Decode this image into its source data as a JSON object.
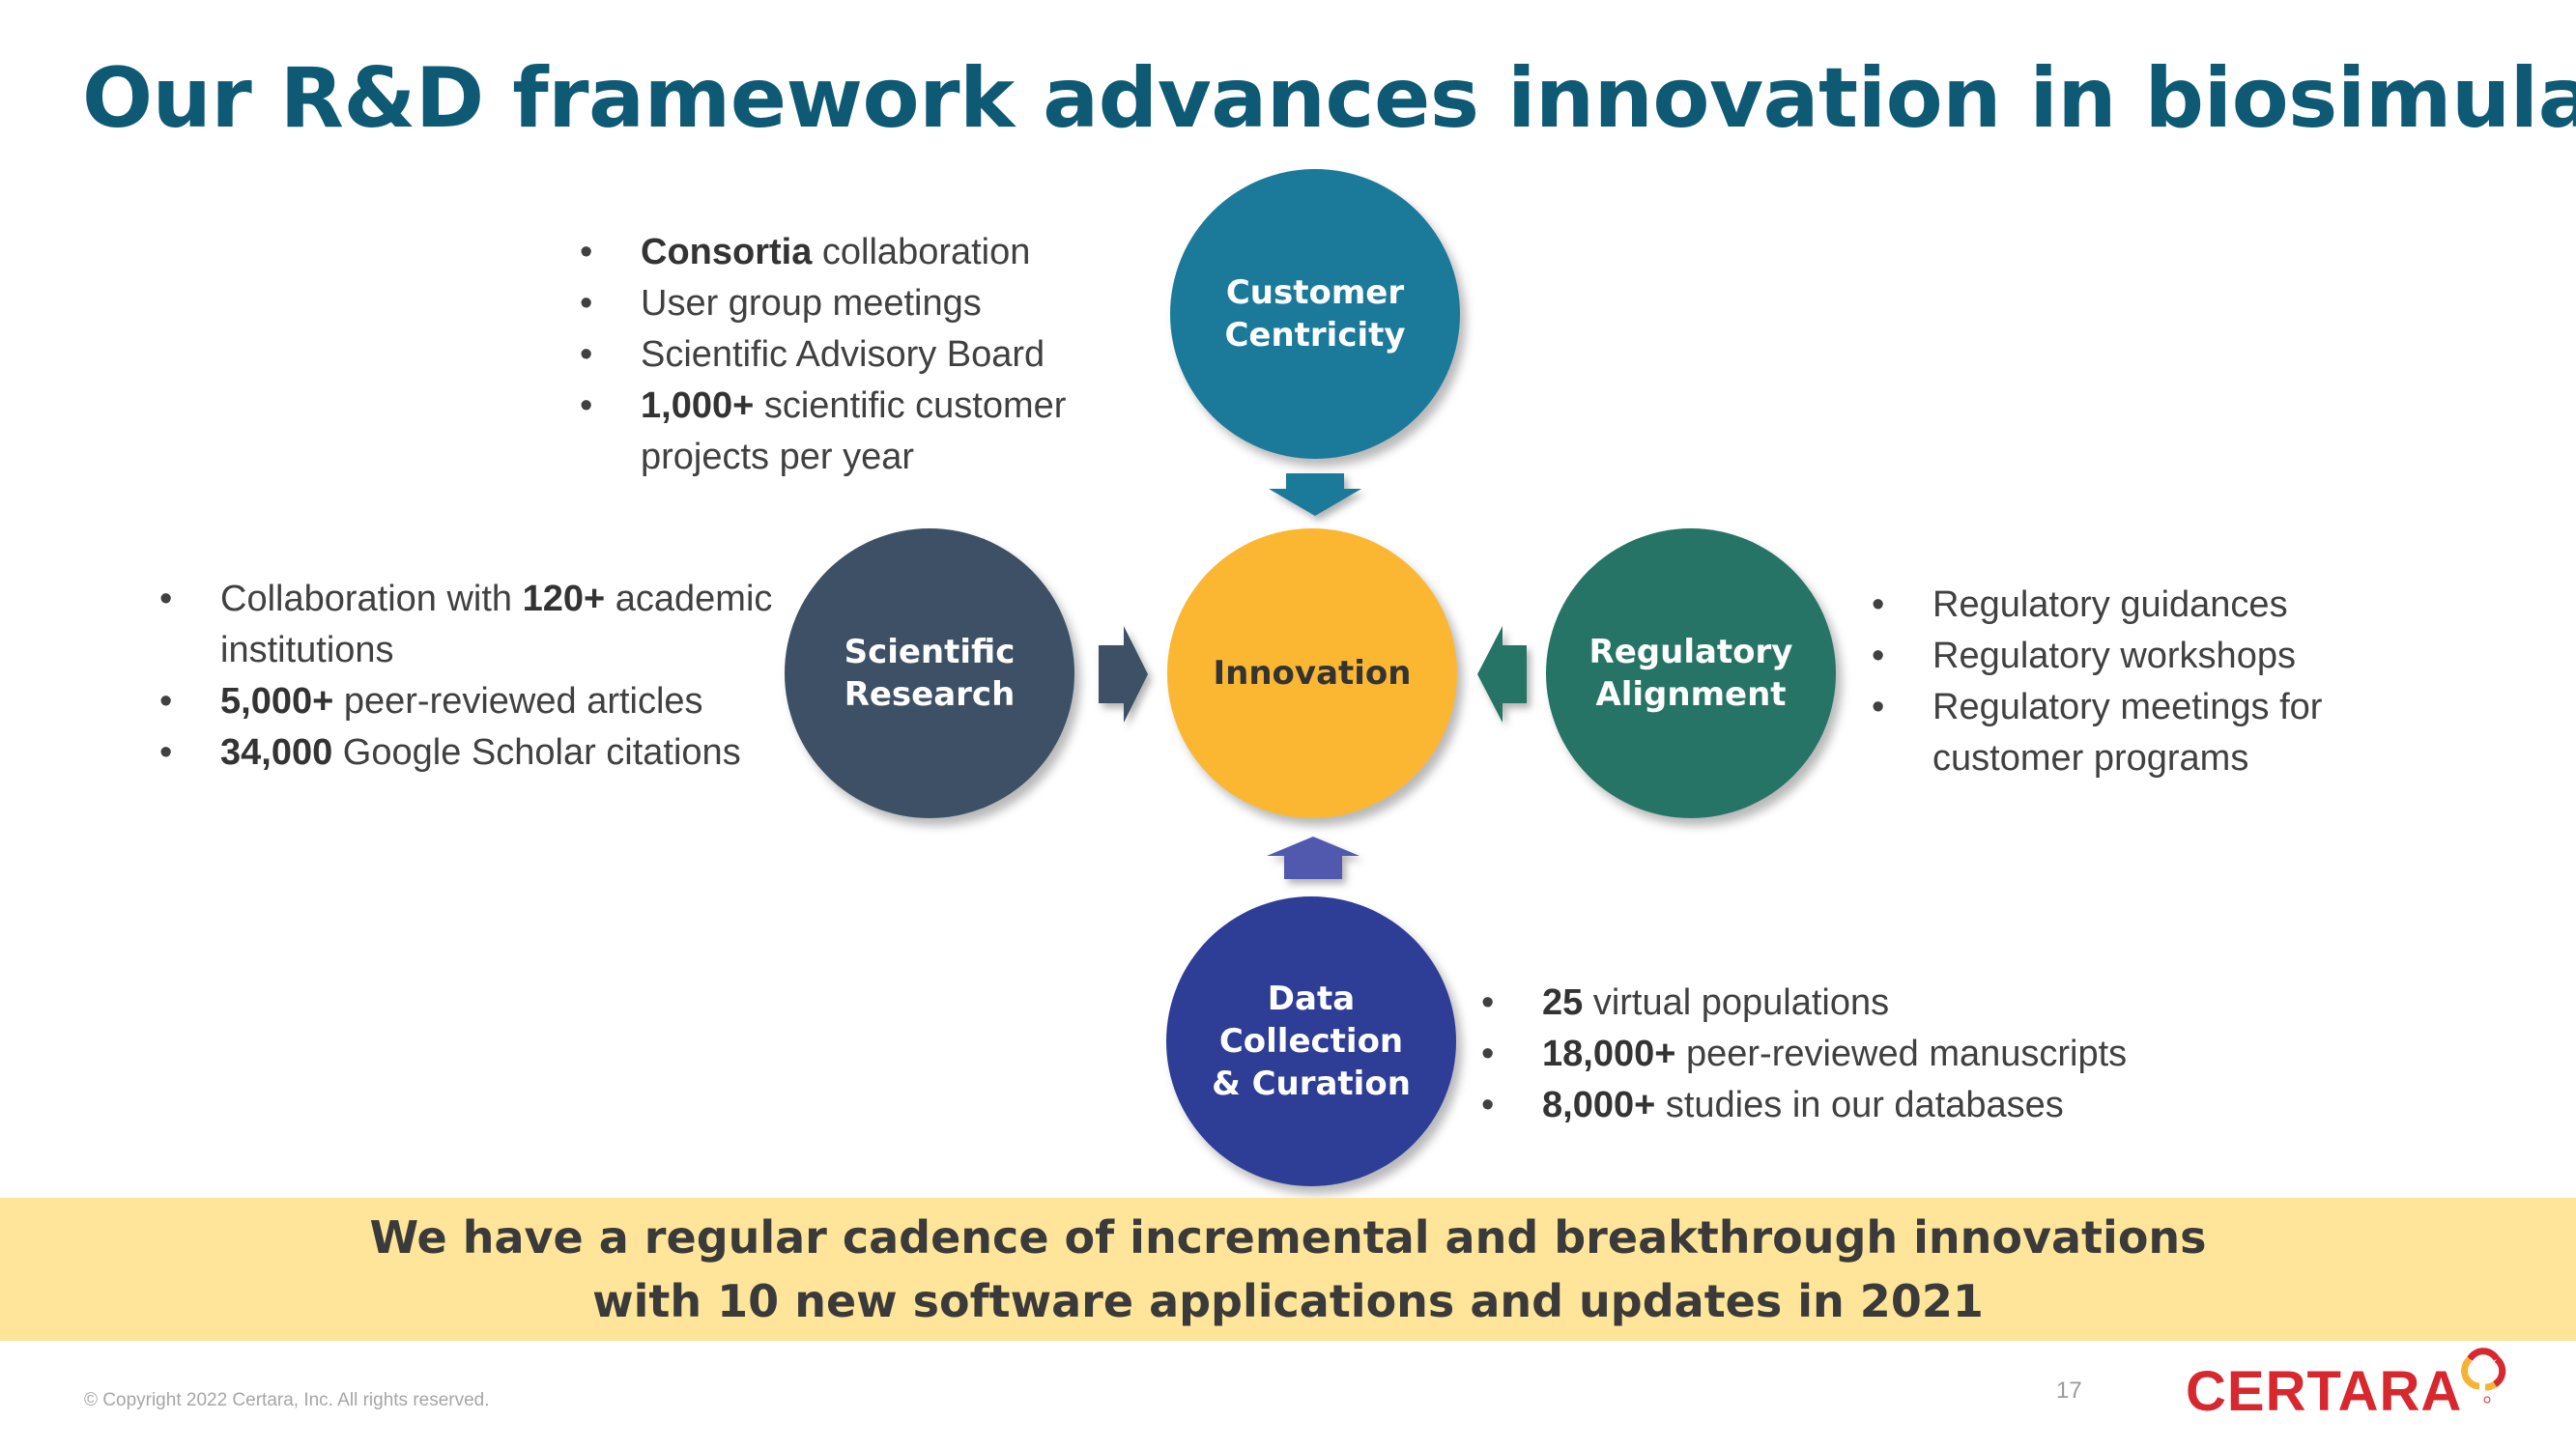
{
  "slide": {
    "title": "Our R&D framework advances innovation in biosimulation",
    "page_number": "17",
    "copyright": "© Copyright 2022 Certara, Inc.  All rights reserved.",
    "logo_text": "CERTARA"
  },
  "colors": {
    "title": "#0e5a75",
    "customer_centricity": "#1b7a9a",
    "innovation": "#fbb731",
    "scientific_research": "#3e5066",
    "regulatory_alignment": "#267465",
    "data_collection": "#2e3d96",
    "banner": "#fee599",
    "logo_red": "#d7282f",
    "logo_yellow": "#f5b335"
  },
  "diagram": {
    "center": {
      "label": "Innovation"
    },
    "nodes": {
      "customer": {
        "label": "Customer\nCentricity",
        "arrow": "arrow-down-icon"
      },
      "science": {
        "label": "Scientific\nResearch",
        "arrow": "arrow-right-icon"
      },
      "regulatory": {
        "label": "Regulatory\nAlignment",
        "arrow": "arrow-left-icon"
      },
      "data": {
        "label": "Data\nCollection\n& Curation",
        "arrow": "arrow-up-icon"
      }
    }
  },
  "bullets": {
    "customer": [
      {
        "bold": "Consortia",
        "text": " collaboration"
      },
      {
        "bold": "",
        "text": "User group meetings"
      },
      {
        "bold": "",
        "text": "Scientific Advisory Board"
      },
      {
        "bold": "1,000+",
        "text": " scientific customer projects per year"
      }
    ],
    "science": [
      {
        "pre": "Collaboration with ",
        "bold": "120+",
        "text": " academic institutions"
      },
      {
        "pre": "",
        "bold": "5,000+",
        "text": " peer-reviewed articles"
      },
      {
        "pre": "",
        "bold": "34,000",
        "text": " Google Scholar citations"
      }
    ],
    "regulatory": [
      {
        "bold": "",
        "text": "Regulatory guidances"
      },
      {
        "bold": "",
        "text": "Regulatory workshops"
      },
      {
        "bold": "",
        "text": "Regulatory meetings for customer programs"
      }
    ],
    "data": [
      {
        "bold": "25",
        "text": " virtual populations"
      },
      {
        "bold": "18,000+",
        "text": " peer-reviewed manuscripts"
      },
      {
        "bold": "8,000+",
        "text": " studies in our databases"
      }
    ]
  },
  "banner": {
    "line1": "We have a regular cadence of incremental and breakthrough innovations",
    "line2": "with 10 new software applications and updates in 2021"
  }
}
